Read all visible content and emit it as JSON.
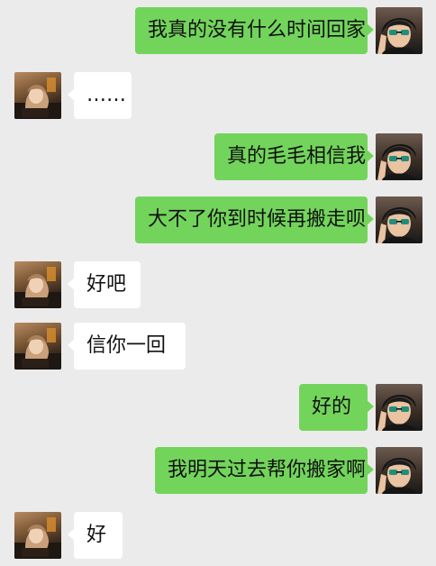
{
  "chat": {
    "messages": [
      {
        "side": "right",
        "text": "我真的没有什么时间回家"
      },
      {
        "side": "left",
        "text": "……"
      },
      {
        "side": "right",
        "text": "真的毛毛相信我"
      },
      {
        "side": "right",
        "text": "大不了你到时候再搬走呗"
      },
      {
        "side": "left",
        "text": "好吧"
      },
      {
        "side": "left",
        "text": "信你一回"
      },
      {
        "side": "right",
        "text": "好的"
      },
      {
        "side": "right",
        "text": "我明天过去帮你搬家啊"
      },
      {
        "side": "left",
        "text": "好"
      }
    ]
  }
}
